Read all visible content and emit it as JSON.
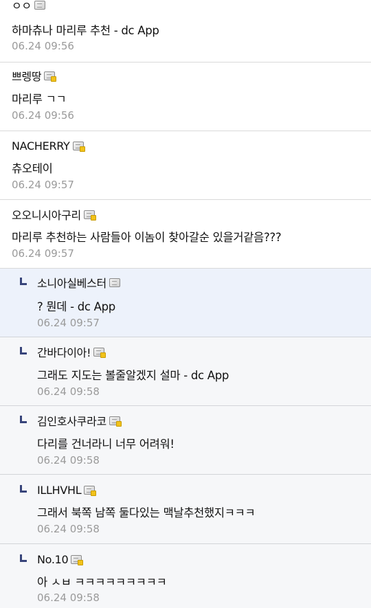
{
  "comments": [
    {
      "nick": "ㅇㅇ",
      "content": "하마츄나 마리루 추천 - dc App",
      "date": "06.24 09:56",
      "reply": false,
      "icon": "member-icon"
    },
    {
      "nick": "쁘렝땅",
      "content": "마리루 ㄱㄱ",
      "date": "06.24 09:56",
      "reply": false,
      "icon": "member-gold-icon"
    },
    {
      "nick": "NACHERRY",
      "content": "츄오테이",
      "date": "06.24 09:57",
      "reply": false,
      "icon": "member-gold-icon"
    },
    {
      "nick": "오오니시아구리",
      "content": "마리루 추천하는 사람들아 이놈이 찾아갈순 있을거같음???",
      "date": "06.24 09:57",
      "reply": false,
      "icon": "member-gold-icon"
    },
    {
      "nick": "소니아실베스터",
      "content": "? 뭔데 - dc App",
      "date": "06.24 09:57",
      "reply": true,
      "icon": "member-icon"
    },
    {
      "nick": "간바다이아!",
      "content": "그래도 지도는 볼줄알겠지 설마 - dc App",
      "date": "06.24 09:58",
      "reply": true,
      "icon": "member-gold-icon"
    },
    {
      "nick": "김인호사쿠라코",
      "content": "다리를 건너라니 너무 어려워!",
      "date": "06.24 09:58",
      "reply": true,
      "icon": "member-gold-icon"
    },
    {
      "nick": "ILLHVHL",
      "content": "그래서 북쪽 남쪽 둘다있는 맥날추천했지ㅋㅋㅋ",
      "date": "06.24 09:58",
      "reply": true,
      "icon": "member-gold-icon"
    },
    {
      "nick": "No.10",
      "content": "아 ㅅㅂ ㅋㅋㅋㅋㅋㅋㅋㅋㅋ",
      "date": "06.24 09:58",
      "reply": true,
      "icon": "member-gold-icon"
    }
  ]
}
